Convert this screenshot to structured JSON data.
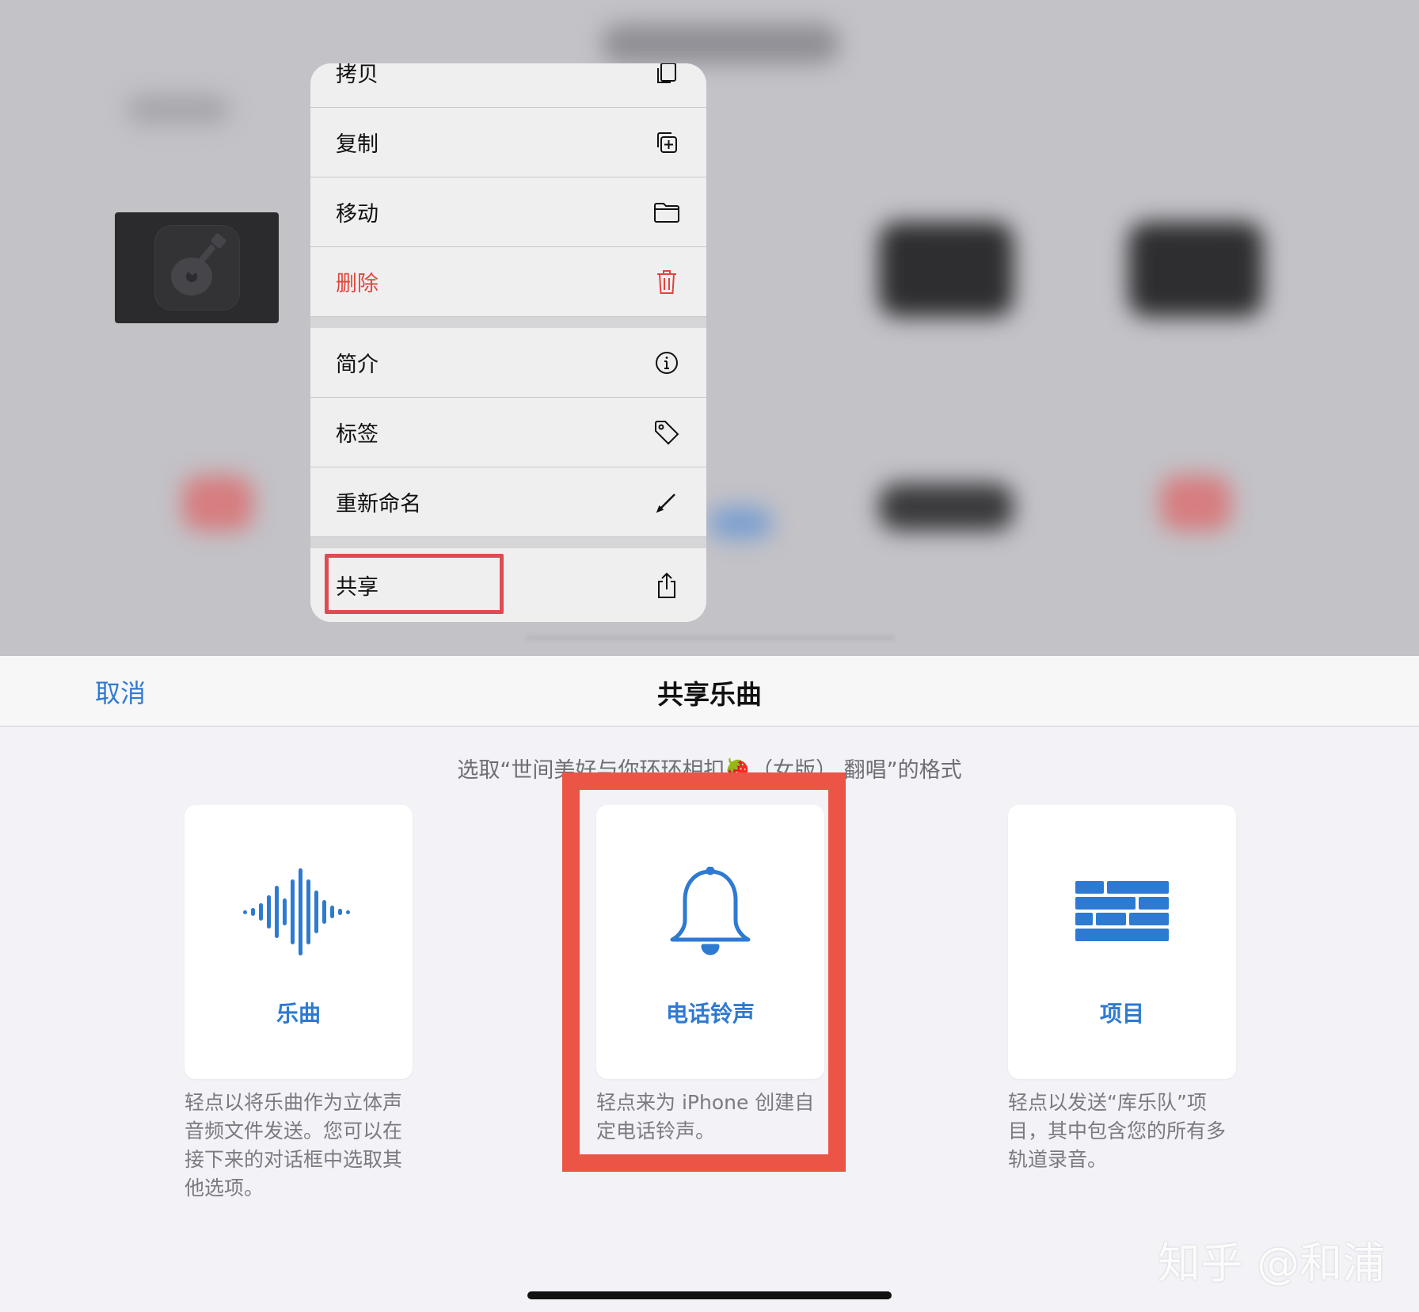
{
  "context_menu": {
    "items": [
      {
        "label": "拷贝",
        "icon": "duplicate-doc-icon"
      },
      {
        "label": "复制",
        "icon": "copy-plus-icon"
      },
      {
        "label": "移动",
        "icon": "folder-icon"
      },
      {
        "label": "删除",
        "icon": "trash-icon",
        "color": "#e0453a"
      },
      {
        "label": "简介",
        "icon": "info-icon"
      },
      {
        "label": "标签",
        "icon": "tag-icon"
      },
      {
        "label": "重新命名",
        "icon": "pencil-icon"
      },
      {
        "label": "共享",
        "icon": "share-icon"
      }
    ]
  },
  "share_sheet": {
    "cancel_label": "取消",
    "title": "共享乐曲",
    "subtitle": "选取“世间美好与你环环相扣🍓（女版）.翻唱”的格式",
    "options": [
      {
        "label": "乐曲",
        "icon": "waveform-icon",
        "description": "轻点以将乐曲作为立体声音频文件发送。您可以在接下来的对话框中选取其他选项。"
      },
      {
        "label": "电话铃声",
        "icon": "bell-icon",
        "description": "轻点来为 iPhone 创建自定电话铃声。"
      },
      {
        "label": "项目",
        "icon": "bricks-icon",
        "description": "轻点以发送“库乐队”项目，其中包含您的所有多轨道录音。"
      }
    ]
  },
  "watermark": "知乎 @和浦",
  "colors": {
    "accent": "#2f7ad1",
    "danger": "#e0453a",
    "highlight": "#ec5446"
  }
}
